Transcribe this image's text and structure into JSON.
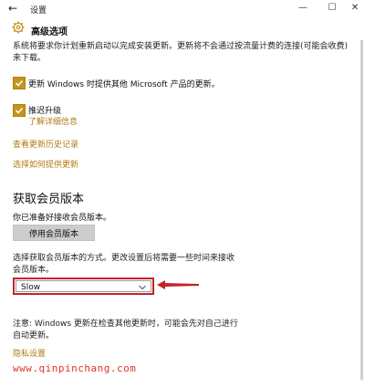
{
  "window": {
    "back_glyph": "←",
    "title": "设置",
    "minimize_glyph": "—",
    "maximize_glyph": "☐",
    "close_glyph": "✕"
  },
  "header": {
    "page_title": "高级选项"
  },
  "intro_text": "系统将要求你计划重新启动以完成安装更新。更新将不会通过按流量计费的连接(可能会收费)来下载。",
  "options": {
    "update_other_products": {
      "label": "更新 Windows 时提供其他 Microsoft 产品的更新。",
      "checked": true
    },
    "defer_upgrades": {
      "label": "推迟升级",
      "checked": true,
      "learn_more": "了解详细信息"
    }
  },
  "links": {
    "view_history": "查看更新历史记录",
    "choose_delivery": "选择如何提供更新"
  },
  "insider": {
    "section_title": "获取会员版本",
    "status_text": "你已准备好接收会员版本。",
    "stop_button": "停用会员版本",
    "choose_text": "选择获取会员版本的方式。更改设置后将需要一些时间来接收会员版本。",
    "ring_selected": "Slow",
    "note": "注意: Windows 更新在检查其他更新时，可能会先对自己进行自动更新。",
    "privacy_link": "隐私设置"
  },
  "watermark": "www.qinpinchang.com",
  "colors": {
    "accent": "#c49319",
    "link": "#b07a12",
    "highlight_red": "#c3242b"
  }
}
